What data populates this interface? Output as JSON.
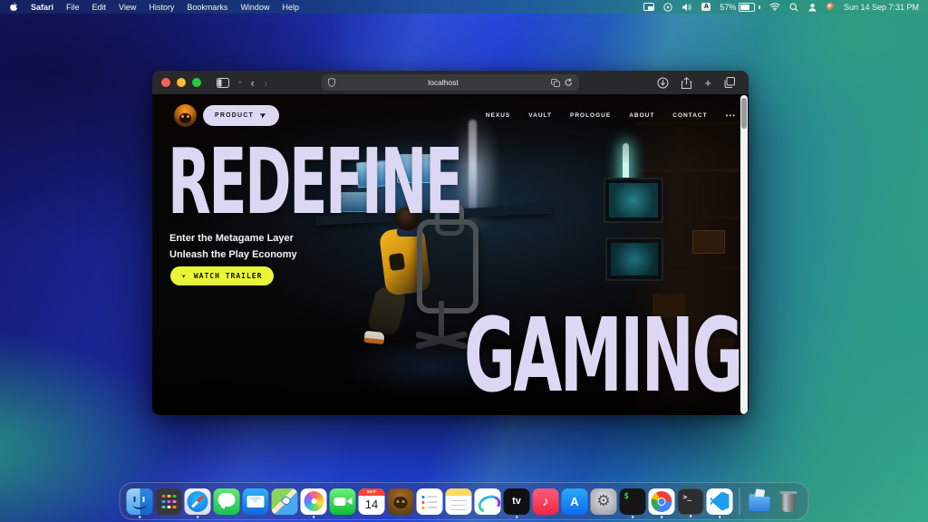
{
  "menubar": {
    "items": [
      "Safari",
      "File",
      "Edit",
      "View",
      "History",
      "Bookmarks",
      "Window",
      "Help"
    ],
    "status": {
      "input_source": "A",
      "battery_percent": "57%",
      "clock": "Sun 14 Sep 7:31 PM"
    }
  },
  "browser": {
    "url": "localhost"
  },
  "site": {
    "product_button": "PRODUCT",
    "nav": [
      "NEXUS",
      "VAULT",
      "PROLOGUE",
      "ABOUT",
      "CONTACT"
    ],
    "nav_more": "•••",
    "hero_title_top": "REDEFINE",
    "hero_title_bottom": "GAMING",
    "tagline_line1": "Enter the Metagame Layer",
    "tagline_line2": "Unleash the Play Economy",
    "cta": "WATCH TRAILER",
    "cursor_glyph": "➤",
    "colors": {
      "accent_yellow": "#e9f636",
      "title_lavender": "#dcd7f2"
    }
  },
  "dock": {
    "apps": [
      "Finder",
      "Launchpad",
      "Safari",
      "Messages",
      "Mail",
      "Maps",
      "Photos",
      "FaceTime",
      "Calendar",
      "Game App",
      "Reminders",
      "Notes",
      "Freeform",
      "TV",
      "Music",
      "App Store",
      "System Settings",
      "Terminal",
      "Chrome",
      "Terminal",
      "VS Code",
      "Downloads",
      "Trash"
    ],
    "calendar_month": "SEP",
    "calendar_day": "14",
    "tv_label": "tv",
    "music_glyph": "♪",
    "appstore_label": "A",
    "settings_glyph": "⚙",
    "terminal1_label": "$",
    "terminal2_label": ">_"
  }
}
